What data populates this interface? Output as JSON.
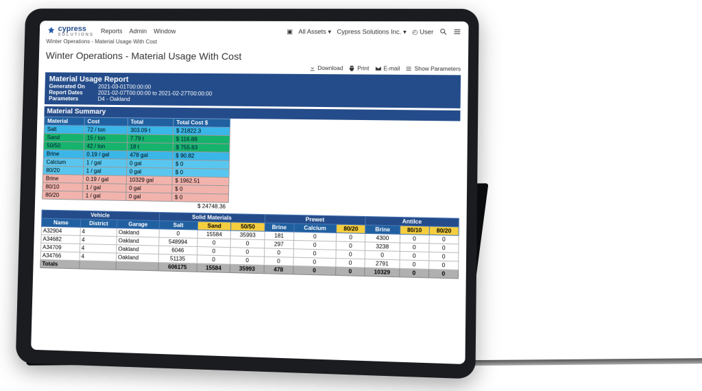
{
  "app": {
    "brand": "cypress",
    "brand_sub": "SOLUTIONS",
    "menu": [
      "Reports",
      "Admin",
      "Window"
    ],
    "asset_scope_prefix": "▣",
    "asset_scope": "All Assets",
    "org": "Cypress Solutions Inc.",
    "user_label": "User"
  },
  "breadcrumb": "Winter Operations - Material Usage With Cost",
  "page_title": "Winter Operations - Material Usage With Cost",
  "actions": {
    "download": "Download",
    "print": "Print",
    "email": "E-mail",
    "show_params": "Show Parameters"
  },
  "banner": {
    "title": "Material Usage Report",
    "rows": [
      {
        "label": "Generated On",
        "value": "2021-03-01T00:00:00"
      },
      {
        "label": "Report Dates",
        "value": "2021-02-07T00:00:00 to 2021-02-27T00:00:00"
      },
      {
        "label": "Parameters",
        "value": "D4 - Oakland"
      }
    ]
  },
  "chart_data": {
    "type": "table",
    "title": "Material Summary",
    "columns": [
      "Material",
      "Cost",
      "Total",
      "Total Cost $"
    ],
    "rows": [
      {
        "cls": "row-salt",
        "cells": [
          "Salt",
          "72 / ton",
          "303.09 t",
          "$ 21822.3"
        ]
      },
      {
        "cls": "row-sand",
        "cells": [
          "Sand",
          "15 / ton",
          "7.79 t",
          "$ 116.88"
        ]
      },
      {
        "cls": "row-5050",
        "cells": [
          "50/50",
          "42 / ton",
          "18 t",
          "$ 755.83"
        ]
      },
      {
        "cls": "row-brine1",
        "cells": [
          "Brine",
          "0.19 / gal",
          "478 gal",
          "$ 90.82"
        ]
      },
      {
        "cls": "row-calcium",
        "cells": [
          "Calcium",
          "1 / gal",
          "0 gal",
          "$ 0"
        ]
      },
      {
        "cls": "row-8020a",
        "cells": [
          "80/20",
          "1 / gal",
          "0 gal",
          "$ 0"
        ]
      },
      {
        "cls": "row-brine2",
        "cells": [
          "Brine",
          "0.19 / gal",
          "10329 gal",
          "$ 1962.51"
        ]
      },
      {
        "cls": "row-8010",
        "cells": [
          "80/10",
          "1 / gal",
          "0 gal",
          "$ 0"
        ]
      },
      {
        "cls": "row-8020b",
        "cells": [
          "80/20",
          "1 / gal",
          "0 gal",
          "$ 0"
        ]
      }
    ],
    "grand_total": "$ 24748.36"
  },
  "vehicle_table": {
    "group_headers": {
      "vehicle": "Vehicle",
      "solid": "Solid Materials",
      "prewet": "Prewet",
      "antiice": "AntiIce"
    },
    "columns": [
      "Name",
      "District",
      "Garage",
      "Salt",
      "Sand",
      "50/50",
      "Brine",
      "Calcium",
      "80/20",
      "Brine",
      "80/10",
      "80/20"
    ],
    "rows": [
      {
        "cells": [
          "A32904",
          "4",
          "Oakland",
          "0",
          "15584",
          "35993",
          "181",
          "0",
          "0",
          "4300",
          "0",
          "0"
        ]
      },
      {
        "cells": [
          "A34682",
          "4",
          "Oakland",
          "548994",
          "0",
          "0",
          "297",
          "0",
          "0",
          "3238",
          "0",
          "0"
        ]
      },
      {
        "cells": [
          "A34709",
          "4",
          "Oakland",
          "6046",
          "0",
          "0",
          "0",
          "0",
          "0",
          "0",
          "0",
          "0"
        ]
      },
      {
        "cells": [
          "A34766",
          "4",
          "Oakland",
          "51135",
          "0",
          "0",
          "0",
          "0",
          "0",
          "2791",
          "0",
          "0"
        ]
      }
    ],
    "totals": [
      "Totals",
      "",
      "",
      "606175",
      "15584",
      "35993",
      "478",
      "0",
      "0",
      "10329",
      "0",
      "0"
    ]
  }
}
